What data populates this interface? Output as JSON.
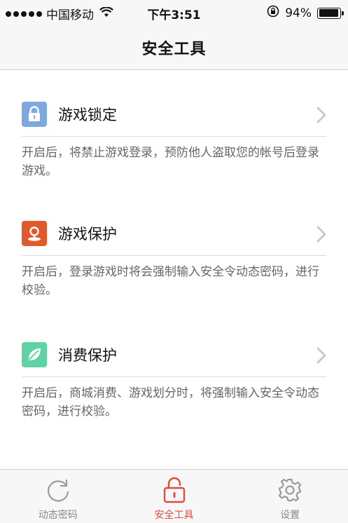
{
  "status_bar": {
    "carrier": "中国移动",
    "time": "下午3:51",
    "battery": "94%",
    "battery_level": 0.94,
    "icons": [
      "signal-dots-icon",
      "wifi-icon",
      "rotation-lock-icon",
      "battery-icon"
    ]
  },
  "nav": {
    "title": "安全工具"
  },
  "tools": [
    {
      "label": "游戏锁定",
      "icon": "lock-icon",
      "color": "#7fa7e0",
      "desc": "开启后，将禁止游戏登录，预防他人盗取您的帐号后登录游戏。"
    },
    {
      "label": "游戏保护",
      "icon": "protect-pin-icon",
      "color": "#e05a2c",
      "desc": "开启后，登录游戏时将会强制输入安全令动态密码，进行校验。"
    },
    {
      "label": "消费保护",
      "icon": "leaf-icon",
      "color": "#5fd3a6",
      "desc": "开启后，商城消费、游戏划分时，将强制输入安全令动态密码，进行校验。"
    }
  ],
  "tabs": [
    {
      "label": "动态密码",
      "icon": "refresh-icon",
      "active": false
    },
    {
      "label": "安全工具",
      "icon": "unlock-icon",
      "active": true
    },
    {
      "label": "设置",
      "icon": "gear-icon",
      "active": false
    }
  ],
  "colors": {
    "accent": "#e24b3b",
    "inactive": "#8a8a8a",
    "chevron": "#c7c7cc"
  }
}
